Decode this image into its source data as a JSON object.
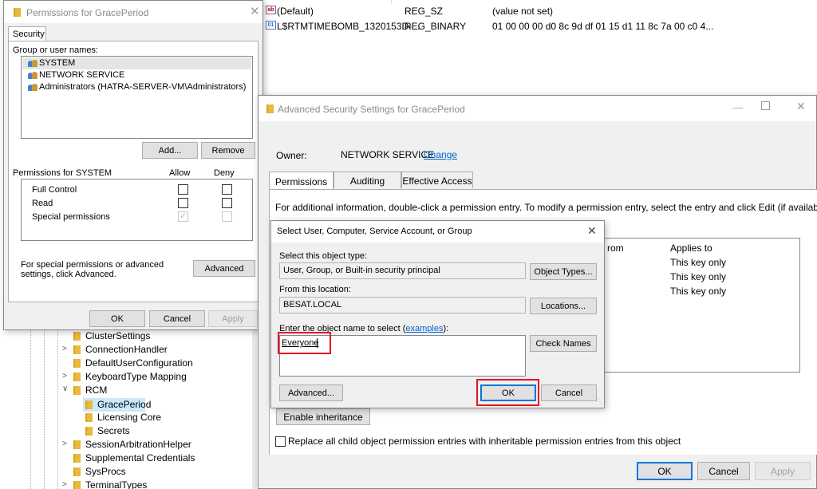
{
  "registry": {
    "values": [
      {
        "name": "(Default)",
        "type": "REG_SZ",
        "data": "(value not set)",
        "icon": "string-value-icon"
      },
      {
        "name": "L$RTMTIMEBOMB_1320153D-...",
        "type": "REG_BINARY",
        "data": "01 00 00 00 d0 8c 9d df 01 15 d1 11 8c 7a 00 c0 4...",
        "icon": "binary-value-icon"
      }
    ],
    "tree": [
      {
        "label": "ClusterSettings",
        "expander": ""
      },
      {
        "label": "ConnectionHandler",
        "expander": ">"
      },
      {
        "label": "DefaultUserConfiguration",
        "expander": ""
      },
      {
        "label": "KeyboardType Mapping",
        "expander": ">"
      },
      {
        "label": "RCM",
        "expander": "v"
      },
      {
        "label": "GracePeriod",
        "expander": ""
      },
      {
        "label": "Licensing Core",
        "expander": ""
      },
      {
        "label": "Secrets",
        "expander": ""
      },
      {
        "label": "SessionArbitrationHelper",
        "expander": ">"
      },
      {
        "label": "Supplemental Credentials",
        "expander": ""
      },
      {
        "label": "SysProcs",
        "expander": ""
      },
      {
        "label": "TerminalTypes",
        "expander": ">"
      }
    ]
  },
  "permissions": {
    "title": "Permissions for GracePeriod",
    "tab": "Security",
    "group_label": "Group or user names:",
    "users": [
      "SYSTEM",
      "NETWORK SERVICE",
      "Administrators (HATRA-SERVER-VM\\Administrators)"
    ],
    "add": "Add...",
    "remove": "Remove",
    "perm_header": "Permissions for SYSTEM",
    "allow": "Allow",
    "deny": "Deny",
    "rows": [
      "Full Control",
      "Read",
      "Special permissions"
    ],
    "note": "For special permissions or advanced settings, click Advanced.",
    "advanced": "Advanced",
    "ok": "OK",
    "cancel": "Cancel",
    "apply": "Apply"
  },
  "advanced": {
    "title": "Advanced Security Settings for GracePeriod",
    "owner_label": "Owner:",
    "owner_value": "NETWORK SERVICE",
    "change": "Change",
    "tabs": [
      "Permissions",
      "Auditing",
      "Effective Access"
    ],
    "info": "For additional information, double-click a permission entry. To modify a permission entry, select the entry and click Edit (if available).",
    "col_from": "rom",
    "col_applies": "Applies to",
    "applies": [
      "This key only",
      "This key only",
      "This key only"
    ],
    "enable_inheritance": "Enable inheritance",
    "replace_label": "Replace all child object permission entries with inheritable permission entries from this object",
    "ok": "OK",
    "cancel": "Cancel",
    "apply": "Apply"
  },
  "select": {
    "title": "Select User, Computer, Service Account, or Group",
    "type_label": "Select this object type:",
    "type_value": "User, Group, or Built-in security principal",
    "object_types": "Object Types...",
    "location_label": "From this location:",
    "location_value": "BESAT.LOCAL",
    "locations": "Locations...",
    "enter_label": "Enter the object name to select (",
    "examples": "examples",
    "enter_suffix": "):",
    "input_value": "Everyone",
    "check_names": "Check Names",
    "advanced": "Advanced...",
    "ok": "OK",
    "cancel": "Cancel"
  },
  "colors": {
    "accent": "#0078d7",
    "highlight": "#e81123",
    "link": "#0066cc"
  }
}
